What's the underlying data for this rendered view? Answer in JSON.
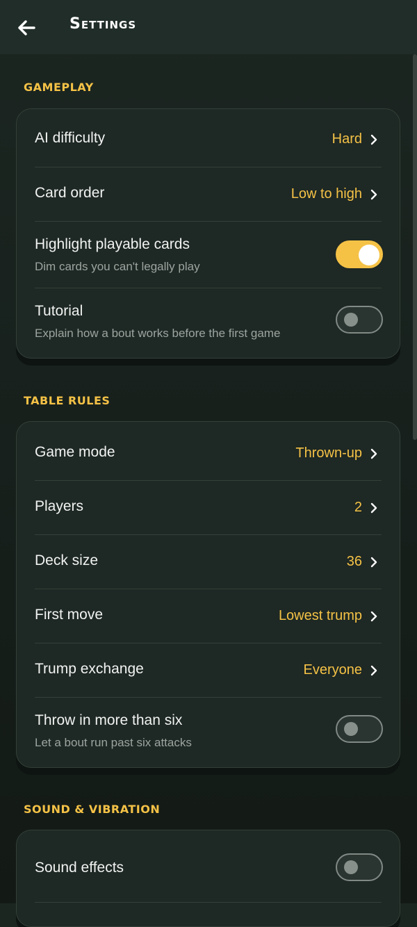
{
  "header": {
    "title": "Settings",
    "back_icon": "arrow-left-icon"
  },
  "colors": {
    "accent": "#f5c246",
    "background": "#18211d",
    "card": "#1e2824"
  },
  "sections": {
    "gameplay": {
      "title": "GAMEPLAY",
      "ai_difficulty": {
        "label": "AI difficulty",
        "value": "Hard"
      },
      "card_order": {
        "label": "Card order",
        "value": "Low to high"
      },
      "highlight": {
        "label": "Highlight playable cards",
        "sub": "Dim cards you can't legally play",
        "on": true
      },
      "tutorial": {
        "label": "Tutorial",
        "sub": "Explain how a bout works before the first game",
        "on": false
      }
    },
    "table_rules": {
      "title": "TABLE RULES",
      "game_mode": {
        "label": "Game mode",
        "value": "Thrown-up"
      },
      "players": {
        "label": "Players",
        "value": "2"
      },
      "deck_size": {
        "label": "Deck size",
        "value": "36"
      },
      "first_move": {
        "label": "First move",
        "value": "Lowest trump"
      },
      "trump_exchange": {
        "label": "Trump exchange",
        "value": "Everyone"
      },
      "throw_in": {
        "label": "Throw in more than six",
        "sub": "Let a bout run past six attacks",
        "on": false
      }
    },
    "sound": {
      "title": "SOUND & VIBRATION",
      "sound_effects": {
        "label": "Sound effects",
        "on": false
      }
    }
  }
}
